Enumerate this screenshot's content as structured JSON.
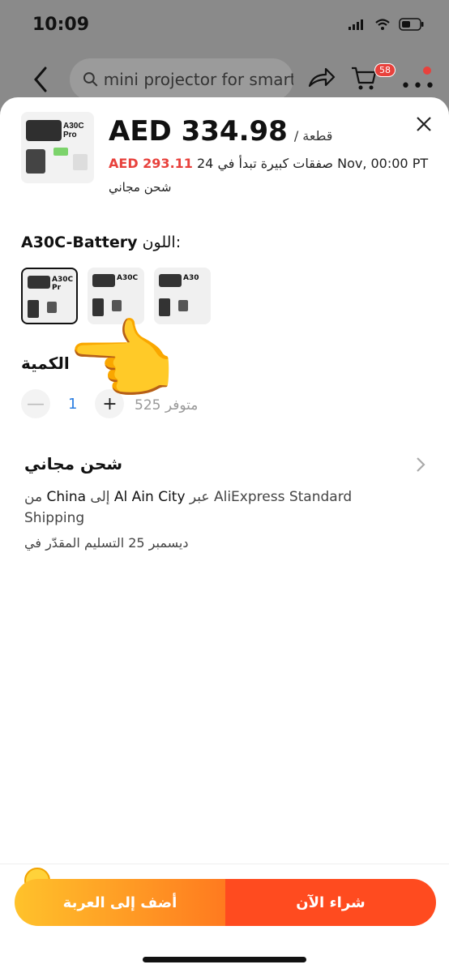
{
  "status_bar": {
    "time": "10:09"
  },
  "nav": {
    "search_text": "mini projector for smart",
    "cart_badge": "58"
  },
  "product": {
    "thumb_label": "A30C Pro",
    "price": "AED 334.98",
    "price_unit": "/ قطعة",
    "deal_price": "AED 293.11",
    "deal_text": "صفقات كبيرة تبدأ في 24 Nov, 00:00 PT",
    "free_shipping": "شحن مجاني"
  },
  "color": {
    "label": "اللون:",
    "selected": "A30C-Battery",
    "variants": [
      {
        "label": "A30C Pr"
      },
      {
        "label": "A30C"
      },
      {
        "label": "A30"
      }
    ]
  },
  "quantity": {
    "title": "الكمية",
    "value": "1",
    "stock": "525 متوفر"
  },
  "shipping": {
    "title": "شحن مجاني",
    "route_from": "China",
    "route_to": "Al Ain City",
    "route_text_pre": "من",
    "route_text_mid": "إلى",
    "route_text_via": "عبر",
    "carrier": "AliExpress Standard Shipping",
    "delivery": "ديسمبر 25 التسليم المقدّر في"
  },
  "actions": {
    "add_to_cart": "أضف إلى العربة",
    "buy_now": "شراء الآن"
  }
}
